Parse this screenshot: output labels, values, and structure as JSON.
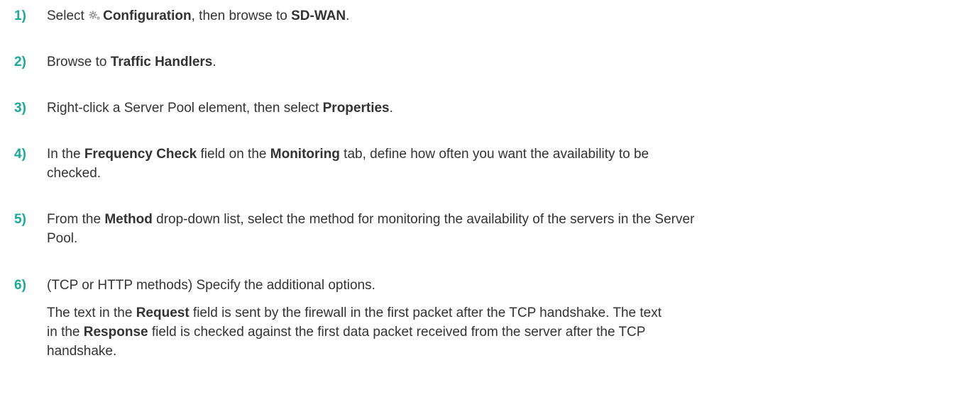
{
  "colors": {
    "step_number": "#1aa99a",
    "body_text": "#333333"
  },
  "steps": [
    {
      "number": "1)",
      "parts": [
        "Select ",
        "Configuration",
        ", then browse to ",
        "SD-WAN",
        "."
      ],
      "icon": "gear-icon"
    },
    {
      "number": "2)",
      "parts": [
        "Browse to ",
        "Traffic Handlers",
        "."
      ]
    },
    {
      "number": "3)",
      "parts": [
        "Right-click a Server Pool element, then select ",
        "Properties",
        "."
      ]
    },
    {
      "number": "4)",
      "line1": [
        "In the ",
        "Frequency Check",
        " field on the ",
        "Monitoring",
        " tab, define how often you want the availability to be"
      ],
      "line2": "checked."
    },
    {
      "number": "5)",
      "line1": [
        "From the ",
        "Method",
        " drop-down list, select the method for monitoring the availability of the servers in the Server"
      ],
      "line2": "Pool."
    },
    {
      "number": "6)",
      "text": "(TCP or HTTP methods) Specify the additional options.",
      "note_line1": [
        "The text in the ",
        "Request",
        " field is sent by the firewall in the first packet after the TCP handshake. The text"
      ],
      "note_line2": [
        "in the ",
        "Response",
        " field is checked against the first data packet received from the server after the TCP"
      ],
      "note_line3": "handshake."
    }
  ]
}
